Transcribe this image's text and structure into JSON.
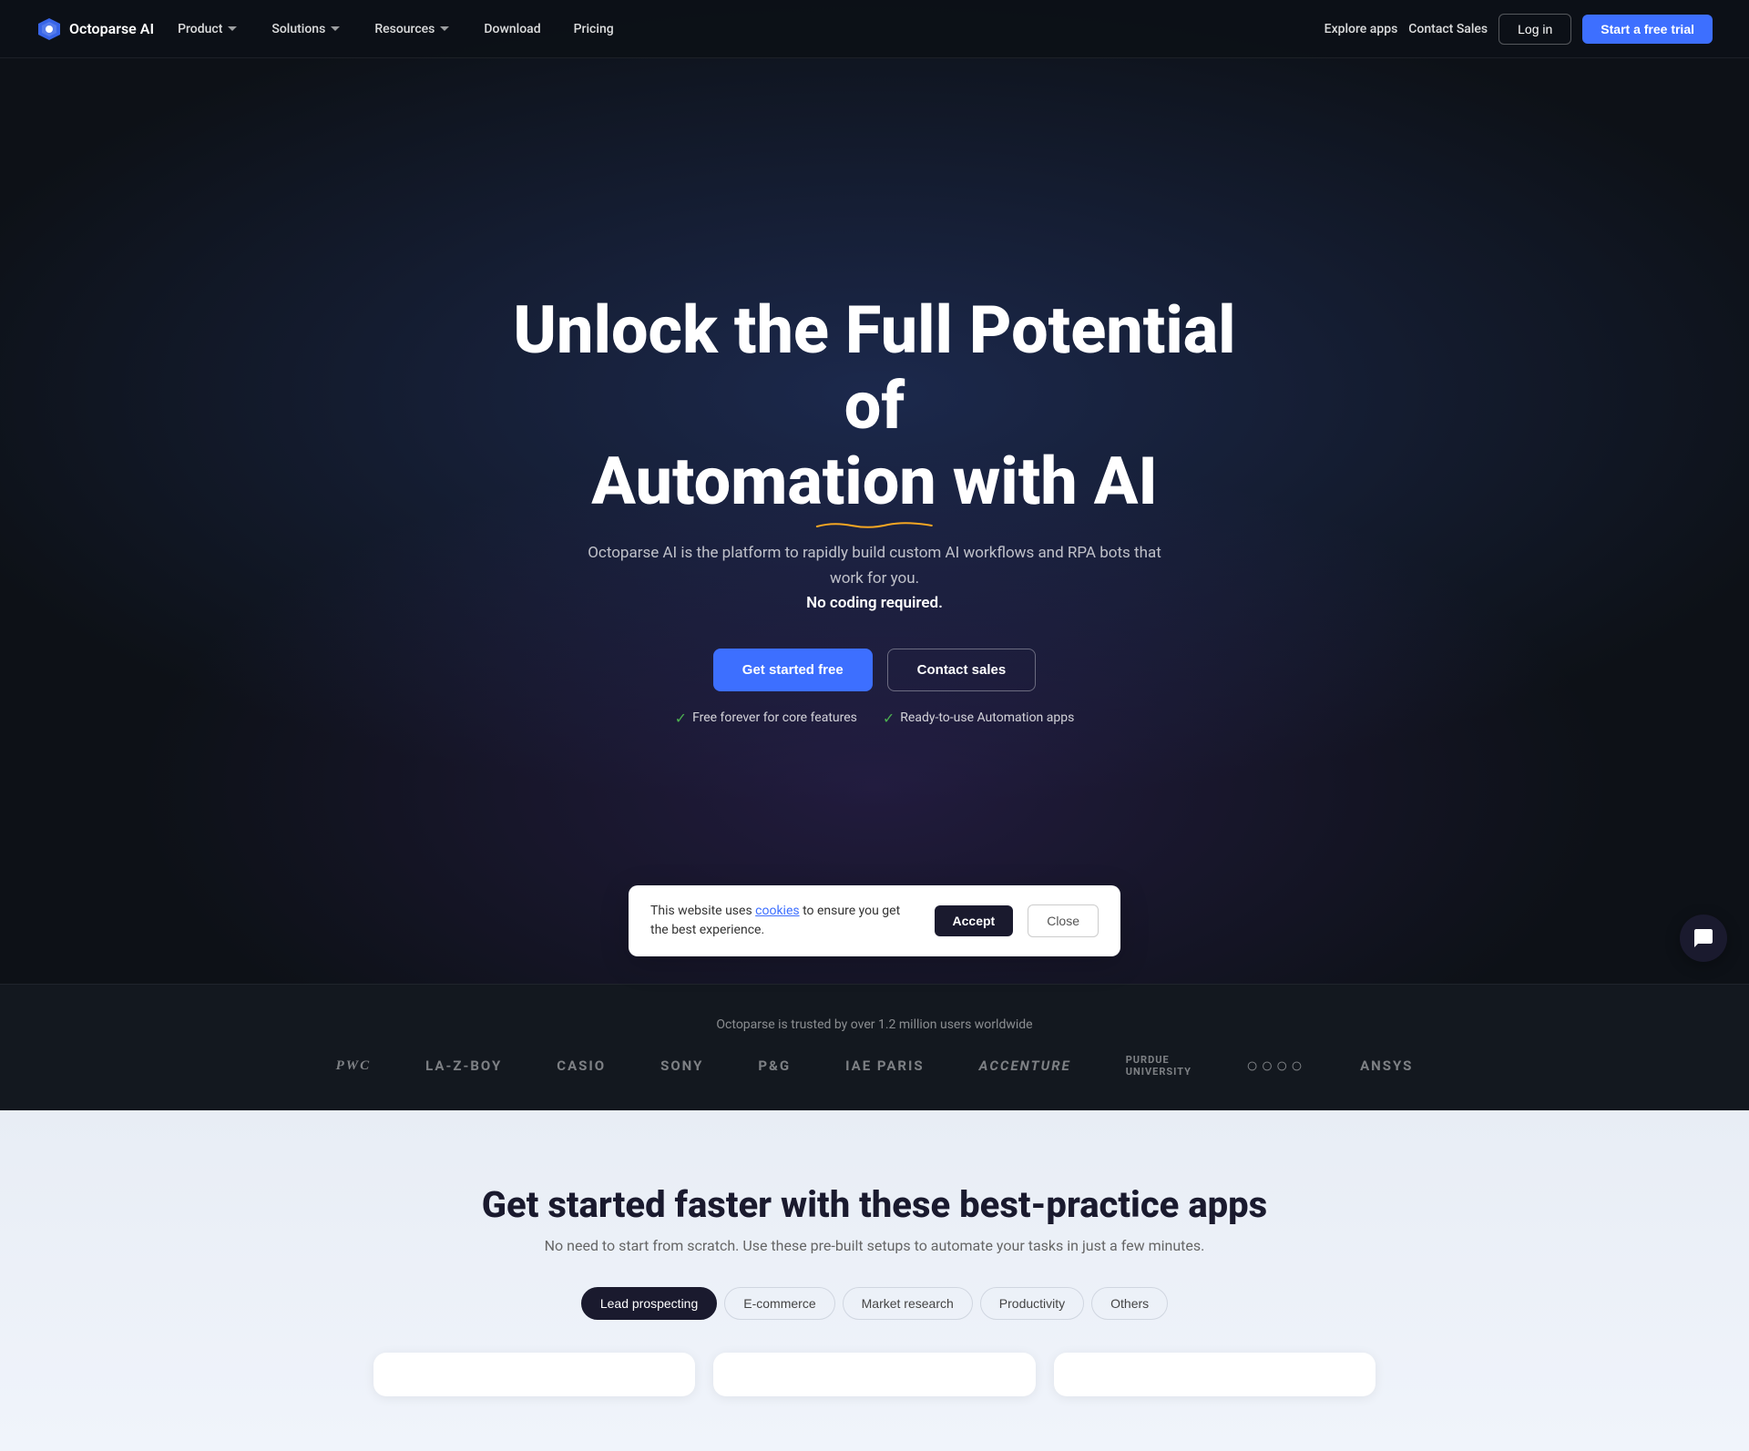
{
  "brand": {
    "name": "Octoparse AI",
    "logo_alt": "Octoparse AI Logo"
  },
  "nav": {
    "links": [
      {
        "label": "Product",
        "has_dropdown": true
      },
      {
        "label": "Solutions",
        "has_dropdown": true
      },
      {
        "label": "Resources",
        "has_dropdown": true
      },
      {
        "label": "Download",
        "has_dropdown": false
      },
      {
        "label": "Pricing",
        "has_dropdown": false
      }
    ],
    "explore_label": "Explore apps",
    "contact_label": "Contact Sales",
    "login_label": "Log in",
    "trial_label": "Start a free trial"
  },
  "hero": {
    "title_line1": "Unlock the Full Potential of",
    "title_line2": "Automation with AI",
    "subtitle": "Octoparse AI is the platform to rapidly build custom AI workflows and RPA bots that work for you.",
    "subtitle_strong": "No coding required.",
    "btn_primary": "Get started free",
    "btn_secondary": "Contact sales",
    "feature1": "Free forever for core features",
    "feature2": "Ready-to-use Automation apps"
  },
  "trusted": {
    "text": "Octoparse is trusted by over 1.2 million users worldwide",
    "logos": [
      {
        "name": "PwC",
        "style": "serif"
      },
      {
        "name": "LA-Z-BOY",
        "style": "normal"
      },
      {
        "name": "CASIO",
        "style": "normal"
      },
      {
        "name": "SONY",
        "style": "normal"
      },
      {
        "name": "P&G",
        "style": "normal"
      },
      {
        "name": "IAE PARIS",
        "style": "normal"
      },
      {
        "name": "accenture",
        "style": "normal"
      },
      {
        "name": "PURDUE UNIVERSITY",
        "style": "normal"
      },
      {
        "name": "Audi",
        "style": "normal"
      },
      {
        "name": "Ansys",
        "style": "normal"
      }
    ]
  },
  "apps_section": {
    "title": "Get started faster with these best-practice apps",
    "subtitle": "No need to start from scratch. Use these pre-built setups to automate your tasks in just a few minutes.",
    "tabs": [
      {
        "label": "Lead prospecting",
        "active": true
      },
      {
        "label": "E-commerce",
        "active": false
      },
      {
        "label": "Market research",
        "active": false
      },
      {
        "label": "Productivity",
        "active": false
      },
      {
        "label": "Others",
        "active": false
      }
    ]
  },
  "cookie": {
    "text": "This website uses",
    "link_text": "cookies",
    "text2": "to ensure you get the best experience.",
    "accept_label": "Accept",
    "close_label": "Close"
  }
}
